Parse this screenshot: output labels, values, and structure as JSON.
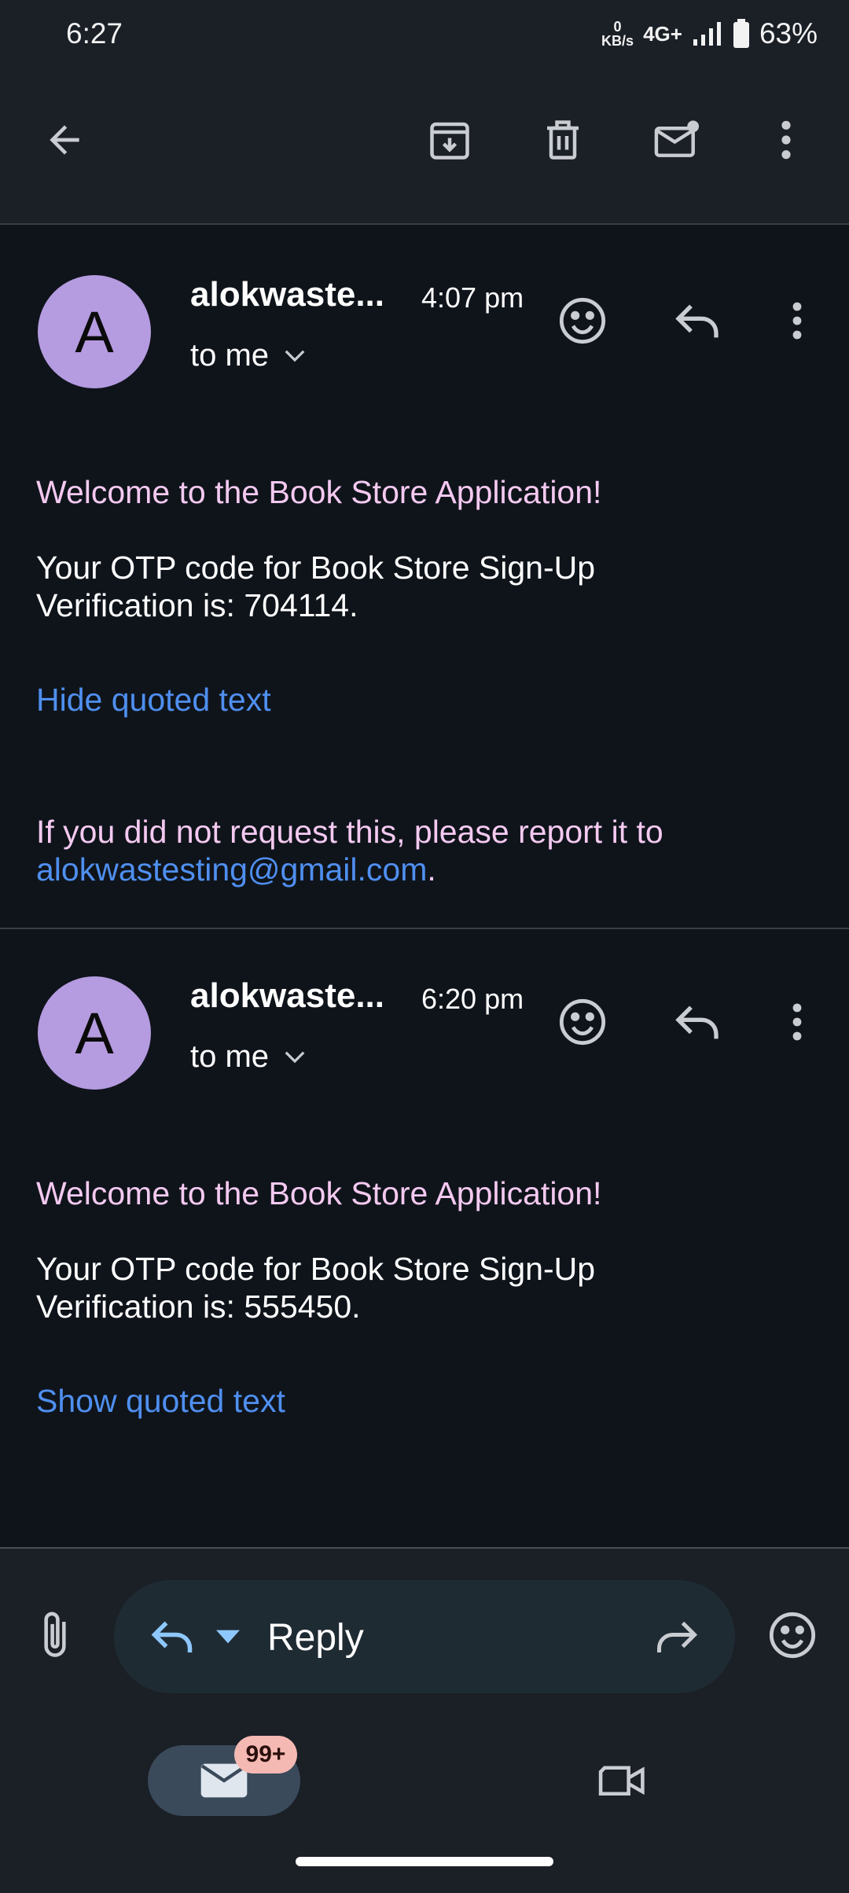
{
  "status_bar": {
    "time": "6:27",
    "net_speed_value": "0",
    "net_speed_unit": "KB/s",
    "network": "4G+",
    "battery": "63%"
  },
  "toolbar": {
    "icons": [
      "back-arrow-icon",
      "archive-icon",
      "delete-icon",
      "mark-unread-icon",
      "more-vert-icon"
    ]
  },
  "messages": [
    {
      "avatar_letter": "A",
      "sender": "alokwaste...",
      "time": "4:07 pm",
      "recipient": "to me",
      "greeting": "Welcome to the Book Store Application!",
      "otp_line1": "Your OTP code for Book Store Sign-Up",
      "otp_line2": "Verification is: 704114.",
      "quoted_toggle": "Hide quoted text",
      "report_text": "If you did not request this, please report it to",
      "report_email": "alokwastesting@gmail.com",
      "report_end": "."
    },
    {
      "avatar_letter": "A",
      "sender": "alokwaste...",
      "time": "6:20 pm",
      "recipient": "to me",
      "greeting": "Welcome to the Book Store Application!",
      "otp_line1": "Your OTP code for Book Store Sign-Up",
      "otp_line2": "Verification is: 555450.",
      "quoted_toggle": "Show quoted text"
    }
  ],
  "reply_bar": {
    "label": "Reply"
  },
  "bottom_nav": {
    "mail_badge": "99+"
  },
  "colors": {
    "background": "#0f141b",
    "avatar": "#b59be0",
    "pink_text": "#f4c9f0",
    "link": "#4f8ff0",
    "badge": "#f5b9b3"
  }
}
